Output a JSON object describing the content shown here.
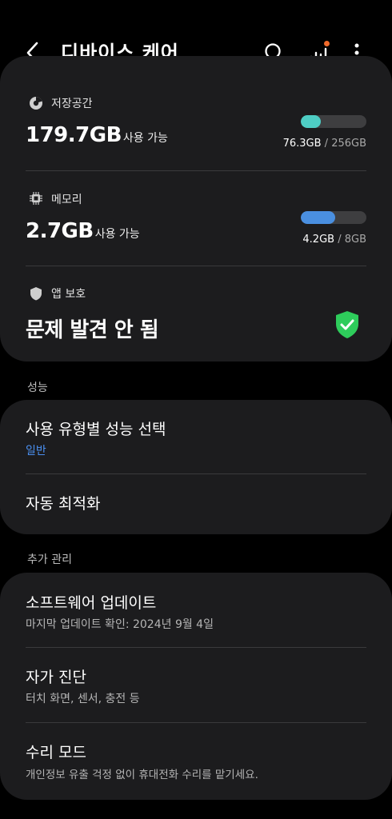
{
  "header": {
    "title": "디바이스 케어",
    "back_icon": "arrow-back-icon",
    "search_icon": "search-icon",
    "stats_icon": "bar-chart-icon",
    "more_icon": "more-vert-icon",
    "notification_dot_color": "#f06a2b"
  },
  "storage": {
    "label": "저장공간",
    "icon": "pie-chart-icon",
    "value": "179.7GB",
    "unit": "사용 가능",
    "used": "76.3GB",
    "total": " / 256GB",
    "used_fraction": 0.3,
    "bar_color": "#4ecdc4"
  },
  "memory": {
    "label": "메모리",
    "icon": "memory-chip-icon",
    "value": "2.7GB",
    "unit": "사용 가능",
    "used": "4.2GB",
    "total": " / 8GB",
    "used_fraction": 0.52,
    "bar_color": "#4a8fe0"
  },
  "app_protection": {
    "label": "앱 보호",
    "icon": "shield-icon",
    "status": "문제 발견 안 됨",
    "status_icon": "shield-check-icon",
    "status_color": "#2ecc5b"
  },
  "performance": {
    "section_title": "성능",
    "items": [
      {
        "title": "사용 유형별 성능 선택",
        "subtitle": "일반"
      },
      {
        "title": "자동 최적화"
      }
    ]
  },
  "extra": {
    "section_title": "추가 관리",
    "items": [
      {
        "title": "소프트웨어 업데이트",
        "subtitle": "마지막 업데이트 확인: 2024년 9월 4일"
      },
      {
        "title": "자가 진단",
        "subtitle": "터치 화면, 센서, 충전 등"
      },
      {
        "title": "수리 모드",
        "subtitle": "개인정보 유출 걱정 없이 휴대전화 수리를 맡기세요."
      }
    ]
  },
  "colors": {
    "background": "#000000",
    "card": "#1c1c1e",
    "accent": "#4a8ff0"
  }
}
